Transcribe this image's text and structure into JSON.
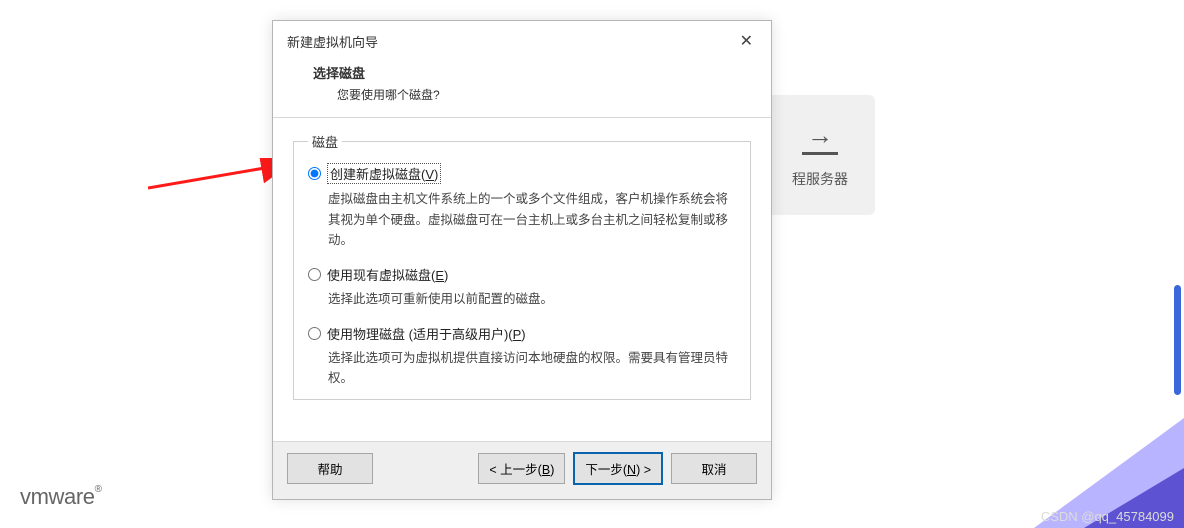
{
  "bg_card": {
    "label": "程服务器"
  },
  "logo": "vmware",
  "watermark": "CSDN @qq_45784099",
  "dialog": {
    "title": "新建虚拟机向导",
    "sub_title": "选择磁盘",
    "sub_question": "您要使用哪个磁盘?",
    "group_legend": "磁盘",
    "options": [
      {
        "label_before": "创建新虚拟磁盘(",
        "accel": "V",
        "label_after": ")",
        "desc": "虚拟磁盘由主机文件系统上的一个或多个文件组成，客户机操作系统会将其视为单个硬盘。虚拟磁盘可在一台主机上或多台主机之间轻松复制或移动。",
        "selected": true
      },
      {
        "label_before": "使用现有虚拟磁盘(",
        "accel": "E",
        "label_after": ")",
        "desc": "选择此选项可重新使用以前配置的磁盘。",
        "selected": false
      },
      {
        "label_before": "使用物理磁盘 (适用于高级用户)(",
        "accel": "P",
        "label_after": ")",
        "desc": "选择此选项可为虚拟机提供直接访问本地硬盘的权限。需要具有管理员特权。",
        "selected": false
      }
    ],
    "buttons": {
      "help": "帮助",
      "back_pre": "< 上一步(",
      "back_accel": "B",
      "back_post": ")",
      "next_pre": "下一步(",
      "next_accel": "N",
      "next_post": ") >",
      "cancel": "取消"
    }
  }
}
